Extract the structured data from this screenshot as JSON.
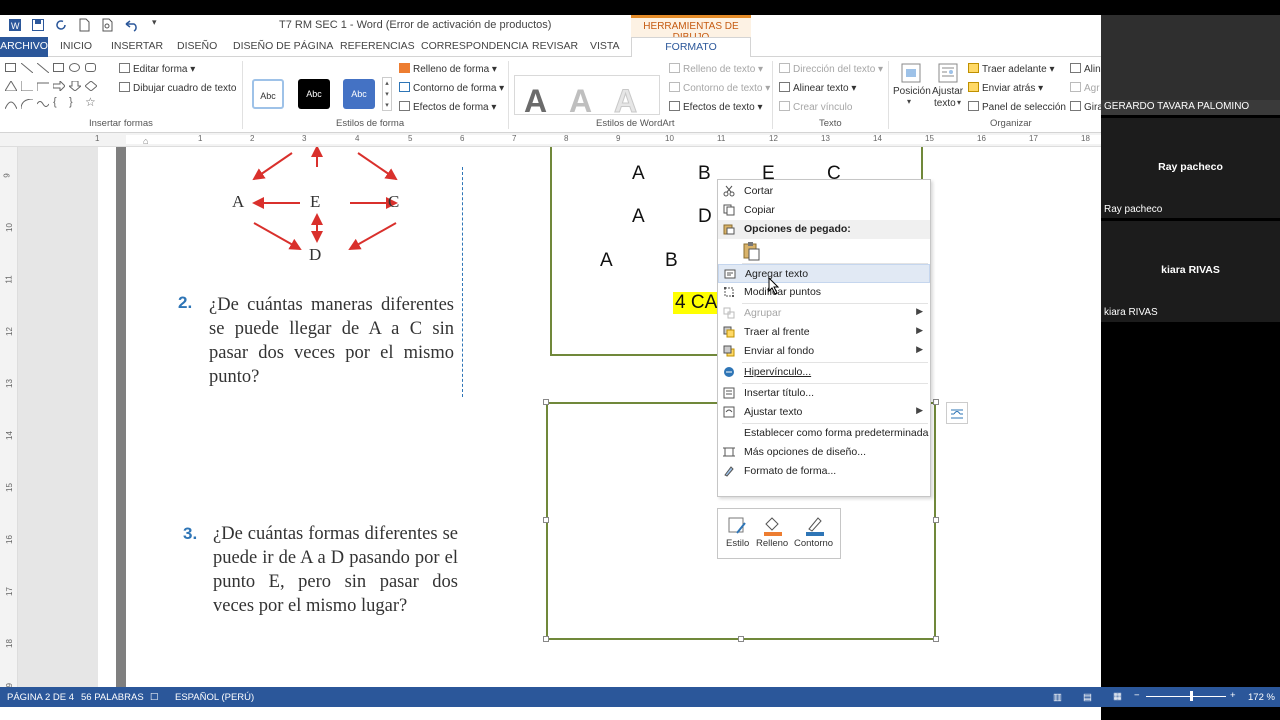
{
  "window": {
    "title": "T7 RM SEC 1 - Word (Error de activación de productos)",
    "context_tab_group": "HERRAMIENTAS DE DIBUJO"
  },
  "tabs": [
    "ARCHIVO",
    "INICIO",
    "INSERTAR",
    "DISEÑO",
    "DISEÑO DE PÁGINA",
    "REFERENCIAS",
    "CORRESPONDENCIA",
    "REVISAR",
    "VISTA",
    "FORMATO"
  ],
  "ribbon": {
    "insert_shapes": {
      "edit_shape": "Editar forma",
      "draw_textbox": "Dibujar cuadro de texto",
      "label": "Insertar formas"
    },
    "shape_styles": {
      "swatches": [
        "Abc",
        "Abc",
        "Abc"
      ],
      "fill": "Relleno de forma",
      "outline": "Contorno de forma",
      "effects": "Efectos de forma",
      "label": "Estilos de forma"
    },
    "wordart": {
      "fill": "Relleno de texto",
      "outline": "Contorno de texto",
      "effects": "Efectos de texto",
      "label": "Estilos de WordArt",
      "letter": "A"
    },
    "text": {
      "direction": "Dirección del texto",
      "align": "Alinear texto",
      "link": "Crear vínculo",
      "label": "Texto"
    },
    "arrange": {
      "position": "Posición",
      "wrap1": "Ajustar",
      "wrap2": "texto",
      "forward": "Traer adelante",
      "backward": "Enviar atrás",
      "selection": "Panel de selección",
      "align_cut": "Alin",
      "group_cut": "Agr",
      "rotate_cut": "Gira",
      "label": "Organizar"
    }
  },
  "ruler": {
    "h": [
      "1",
      "1",
      "2",
      "3",
      "4",
      "5",
      "6",
      "7",
      "8",
      "9",
      "10",
      "11",
      "12",
      "13",
      "14",
      "15",
      "16",
      "17",
      "18"
    ],
    "v": [
      "9",
      "10",
      "11",
      "12",
      "13",
      "14",
      "15",
      "16",
      "17",
      "18",
      "19"
    ]
  },
  "document": {
    "diagram": {
      "a": "A",
      "e": "E",
      "c": "C",
      "d": "D"
    },
    "q2": {
      "num": "2.",
      "text": "¿De cuántas maneras diferentes se puede llegar de A a C sin pasar dos veces por el mismo punto?"
    },
    "q3": {
      "num": "3.",
      "text": "¿De cuántas formas diferentes se puede ir de A a D pasando por el punto E, pero sin pasar dos veces por el mismo lugar?"
    },
    "solution": {
      "row1": [
        "A",
        "B",
        "E",
        "C"
      ],
      "row2": [
        "A",
        "D"
      ],
      "row3": [
        "A",
        "B"
      ],
      "highlight": "4 CA"
    }
  },
  "context_menu": {
    "items": [
      {
        "label": "Cortar",
        "icon": "scissors-icon"
      },
      {
        "label": "Copiar",
        "icon": "copy-icon"
      },
      {
        "label": "Opciones de pegado:",
        "icon": "paste-icon"
      },
      {
        "label": "Agregar texto",
        "icon": "textbox-icon"
      },
      {
        "label": "Modificar puntos",
        "icon": "edit-points-icon"
      },
      {
        "label": "Agrupar",
        "icon": "group-icon"
      },
      {
        "label": "Traer al frente",
        "icon": "bring-front-icon"
      },
      {
        "label": "Enviar al fondo",
        "icon": "send-back-icon"
      },
      {
        "label": "Hipervínculo...",
        "icon": "link-icon"
      },
      {
        "label": "Insertar título...",
        "icon": "caption-icon"
      },
      {
        "label": "Ajustar texto",
        "icon": "wrap-icon"
      },
      {
        "label": "Establecer como forma predeterminada",
        "icon": ""
      },
      {
        "label": "Más opciones de diseño...",
        "icon": "layout-icon"
      },
      {
        "label": "Formato de forma...",
        "icon": "format-icon"
      }
    ]
  },
  "mini_toolbar": {
    "style": "Estilo",
    "fill": "Relleno",
    "outline": "Contorno"
  },
  "status": {
    "page": "PÁGINA 2 DE 4",
    "words": "56 PALABRAS",
    "lang": "ESPAÑOL (PERÚ)",
    "zoom": "172 %"
  },
  "participants": [
    {
      "name": "GERARDO TAVARA PALOMINO"
    },
    {
      "name": "Ray pacheco"
    },
    {
      "name": "kiara RIVAS"
    }
  ],
  "colors": {
    "word_blue": "#2b579a",
    "orange": "#e48c2a",
    "highlight": "#ffff00",
    "arrow_red": "#d9302c",
    "shape_green": "#70883a"
  }
}
